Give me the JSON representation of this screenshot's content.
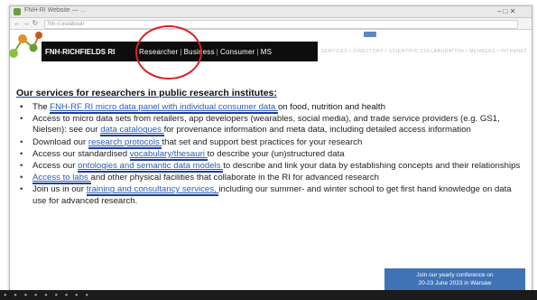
{
  "browser": {
    "tab_title": "FNH-RI Website — …",
    "address_nav": "← → ↻",
    "address_text": "fnh-ri.eu/about/",
    "window_controls": "– □ ✕"
  },
  "site": {
    "brand": "FNH-RICHFIELDS RI",
    "nav": {
      "researcher": "Researcher",
      "business": "Business",
      "consumer": "Consumer",
      "ms": "MS"
    },
    "nav_sep": "|",
    "secondary_nav": "SERVICES • DIRECTORY • SCIENTIFIC COLLABORATION • MEMBERS • INTRANET"
  },
  "content": {
    "heading": "Our services for researchers in public research institutes:",
    "bullets": [
      {
        "pre": "The ",
        "link": "FNH-RF RI micro data panel with individual consumer data ",
        "post": "on food, nutrition and health"
      },
      {
        "pre": "Access to micro data sets from retailers, app developers (wearables, social media), and trade service providers (e.g. GS1, Nielsen): see our ",
        "link": "data catalogues ",
        "post": "for provenance information and meta data, including detailed access information"
      },
      {
        "pre": "Download our ",
        "link": "research protocols ",
        "post": "that set and support best practices for your research"
      },
      {
        "pre": "Access our standardised ",
        "link": "vocabulary/thesauri ",
        "post": "to describe your (un)structured data"
      },
      {
        "pre": "Access our ",
        "link": "ontologies and semantic data models ",
        "post": "to describe and link your data by establishing concepts and their relationships"
      },
      {
        "pre": "",
        "link": "Access to labs ",
        "post": "and other physical facilities that collaborate in the RI for advanced research"
      },
      {
        "pre": "Join us in our ",
        "link": "training and consultancy services, ",
        "post": "including our summer- and winter school to get first hand knowledge on data use for advanced research."
      }
    ],
    "banner": {
      "line1": "Join our yearly conference on",
      "line2": "20-23 June 2023 in Warsaw"
    }
  },
  "colors": {
    "accent_link": "#2a5db0",
    "underline_bar": "#1a3d9e",
    "highlight_ring": "#e02020",
    "tabbar": "#0d0d0d",
    "banner": "#3f73b5"
  }
}
